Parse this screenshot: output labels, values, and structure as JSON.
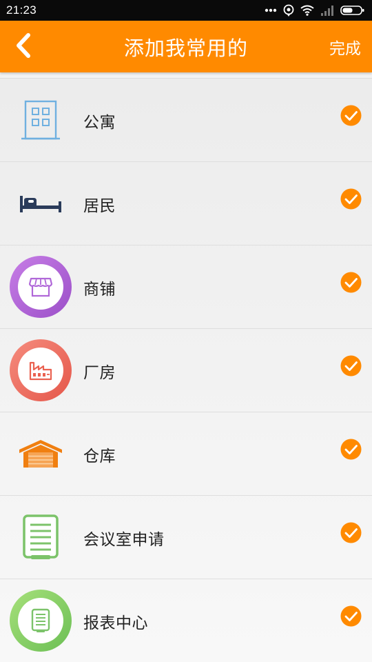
{
  "status_bar": {
    "time": "21:23"
  },
  "header": {
    "back_icon": "chevron-left-icon",
    "title": "添加我常用的",
    "done_label": "完成"
  },
  "colors": {
    "accent": "#ff8a00",
    "status_bar": "#0a0a0a",
    "check": "#ff8a00"
  },
  "items": [
    {
      "label": "公寓",
      "icon": "apartment-building-icon",
      "checked": true
    },
    {
      "label": "居民",
      "icon": "bed-icon",
      "checked": true
    },
    {
      "label": "商铺",
      "icon": "shop-icon",
      "checked": true
    },
    {
      "label": "厂房",
      "icon": "factory-icon",
      "checked": true
    },
    {
      "label": "仓库",
      "icon": "warehouse-icon",
      "checked": true
    },
    {
      "label": "会议室申请",
      "icon": "document-list-icon",
      "checked": true
    },
    {
      "label": "报表中心",
      "icon": "report-icon",
      "checked": true
    }
  ]
}
